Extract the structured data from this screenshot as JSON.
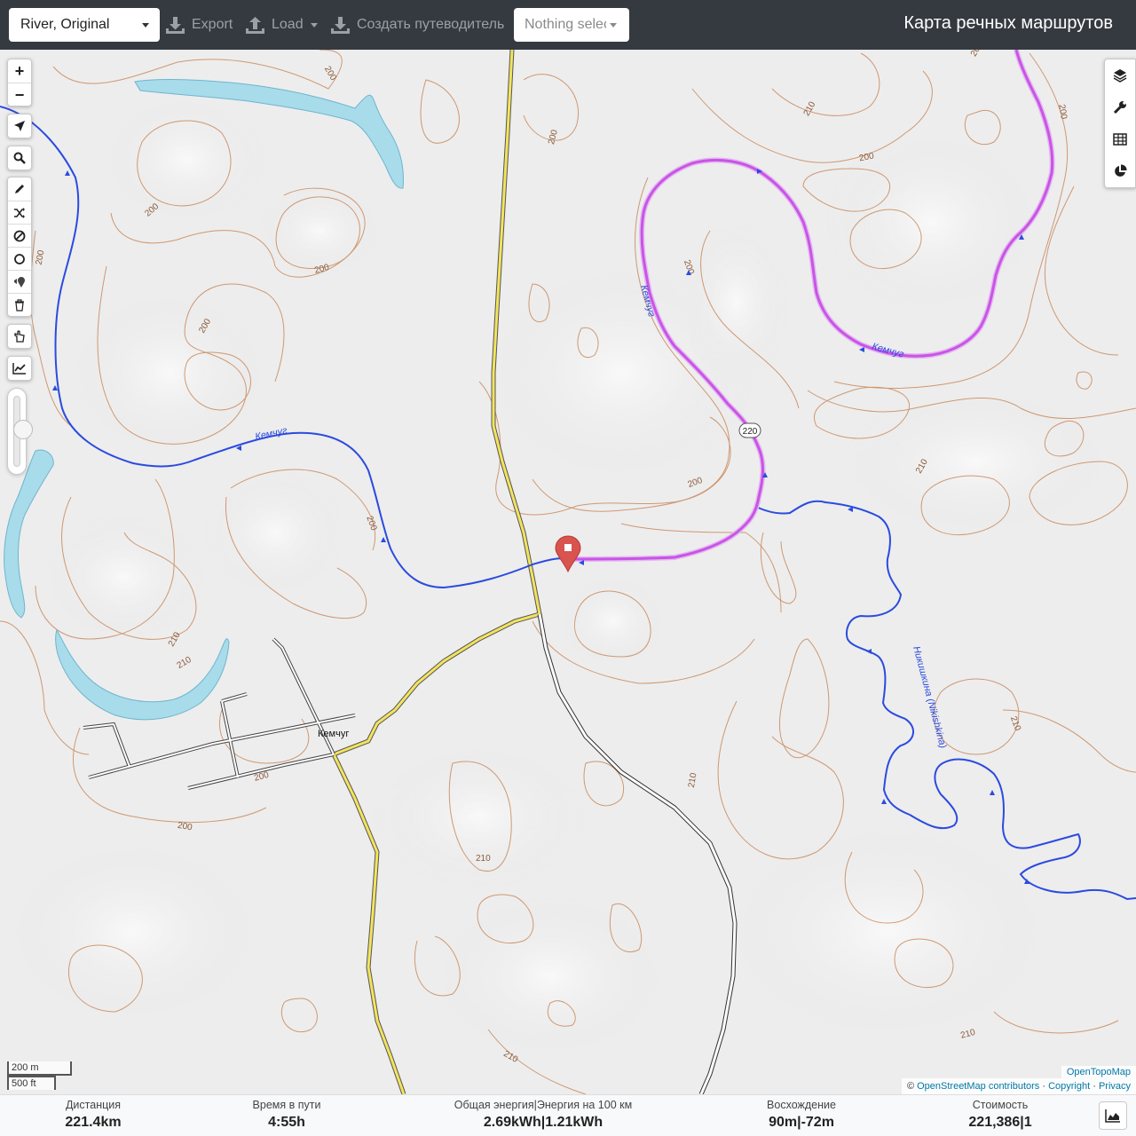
{
  "header": {
    "profile": "River, Original",
    "export_label": "Export",
    "load_label": "Load",
    "guide_label": "Создать путеводитель",
    "selection_placeholder": "Nothing selected",
    "title": "Карта речных маршрутов"
  },
  "map": {
    "labels": {
      "river_left": "Кемчуг",
      "river_mid": "Кемчуг",
      "river_right": "Кемчуг",
      "tributary": "Никишкина (Nikishkina)",
      "village": "Кемчуг",
      "road_shield": "220"
    },
    "contour_labels": [
      "200",
      "200",
      "200",
      "200",
      "200",
      "200",
      "200",
      "200",
      "200",
      "200",
      "200",
      "210",
      "210",
      "210",
      "210",
      "210",
      "210",
      "210",
      "210"
    ],
    "colors": {
      "river": "#2b4be0",
      "route": "#c954e6",
      "water": "#a8dcea",
      "contour": "#c98a5e",
      "road_major": "#e8d94a",
      "marker": "#d9534f"
    }
  },
  "zoom": {
    "in": "+",
    "out": "−"
  },
  "scale": {
    "metric": "200 m",
    "imperial": "500 ft"
  },
  "attribution": {
    "provider": "OpenTopoMap",
    "prefix": "© ",
    "osm": "OpenStreetMap contributors",
    "sep1": " · ",
    "copyright": "Copyright",
    "sep2": " · ",
    "privacy": "Privacy"
  },
  "stats": {
    "distance_label": "Дистанция",
    "distance_value": "221.4km",
    "time_label": "Время в пути",
    "time_value": "4:55h",
    "energy_label": "Общая энергия|Энергия на 100 км",
    "energy_value": "2.69kWh|1.21kWh",
    "ascent_label": "Восхождение",
    "ascent_value": "90m|-72m",
    "cost_label": "Стоимость",
    "cost_value": "221,386|1"
  }
}
